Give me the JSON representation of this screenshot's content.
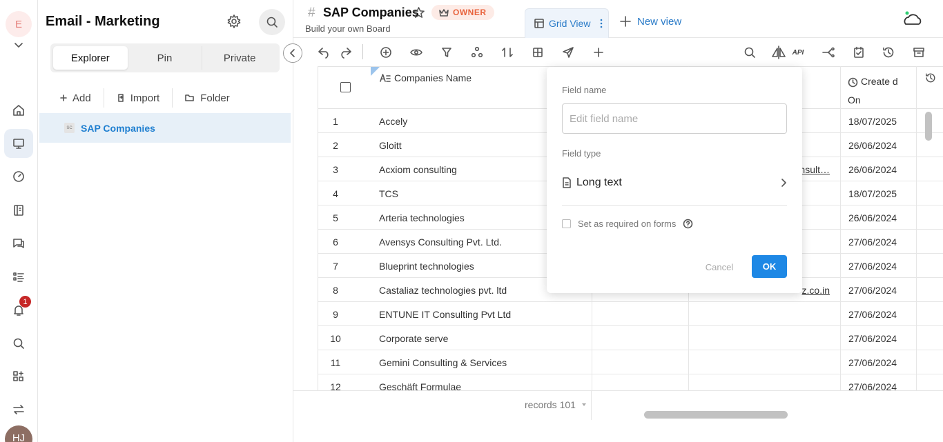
{
  "workspace": {
    "initial": "E",
    "name": "Email - Marketing"
  },
  "user": {
    "initials": "HJ"
  },
  "notifications": {
    "count": "1"
  },
  "sidebar": {
    "tabs": [
      "Explorer",
      "Pin",
      "Private"
    ],
    "active_tab": "Explorer",
    "actions": {
      "add": "Add",
      "import": "Import",
      "folder": "Folder"
    },
    "tree": [
      {
        "badge": "SC",
        "label": "SAP Companies",
        "selected": true
      }
    ]
  },
  "header": {
    "hash": "#",
    "title": "SAP Companies",
    "owner_badge": "OWNER",
    "subtitle": "Build your own Board",
    "view_tab": "Grid View",
    "new_view": "New view"
  },
  "toolbar": {
    "icons": [
      "undo-icon",
      "redo-icon",
      "add-field-icon",
      "eye-icon",
      "filter-icon",
      "group-icon",
      "sort-icon",
      "table-icon",
      "send-icon",
      "plus-icon",
      "search-icon",
      "split-icon",
      "api-icon",
      "share-icon",
      "calendar-icon",
      "history-icon",
      "archive-icon"
    ],
    "api_label": "API"
  },
  "grid": {
    "columns": {
      "name": "Companies Name",
      "created": "Create d On"
    },
    "rows": [
      {
        "num": "1",
        "name": "Accely",
        "email": "",
        "date": "18/07/2025"
      },
      {
        "num": "2",
        "name": "Gloitt",
        "email": "",
        "date": "26/06/2024"
      },
      {
        "num": "3",
        "name": "Acxiom consulting",
        "email": "nsult…",
        "date": "26/06/2024"
      },
      {
        "num": "4",
        "name": "TCS",
        "email": "",
        "date": "18/07/2025"
      },
      {
        "num": "5",
        "name": "Arteria technologies",
        "email": "",
        "date": "26/06/2024"
      },
      {
        "num": "6",
        "name": "Avensys Consulting Pvt. Ltd.",
        "email": "",
        "date": "27/06/2024"
      },
      {
        "num": "7",
        "name": "Blueprint technologies",
        "email": "",
        "date": "27/06/2024"
      },
      {
        "num": "8",
        "name": "Castaliaz technologies pvt. ltd",
        "email": "z.co.in",
        "date": "27/06/2024"
      },
      {
        "num": "9",
        "name": "ENTUNE IT Consulting Pvt Ltd",
        "email": "",
        "date": "27/06/2024"
      },
      {
        "num": "10",
        "name": "Corporate serve",
        "email": "",
        "date": "27/06/2024"
      },
      {
        "num": "11",
        "name": "Gemini Consulting & Services",
        "email": "",
        "date": "27/06/2024"
      },
      {
        "num": "12",
        "name": "Geschäft Formulae",
        "email": "",
        "date": "27/06/2024"
      }
    ]
  },
  "footer": {
    "records": "records 101"
  },
  "field_popup": {
    "field_name_label": "Field name",
    "field_name_placeholder": "Edit field name",
    "field_name_value": "",
    "field_type_label": "Field type",
    "field_type_value": "Long text",
    "required_label": "Set as required on forms",
    "required_checked": false,
    "cancel": "Cancel",
    "ok": "OK"
  },
  "colors": {
    "accent": "#1e88e5",
    "link": "#2a7bc8",
    "owner": "#e8633d",
    "selected_bg": "#e7f0f8"
  }
}
